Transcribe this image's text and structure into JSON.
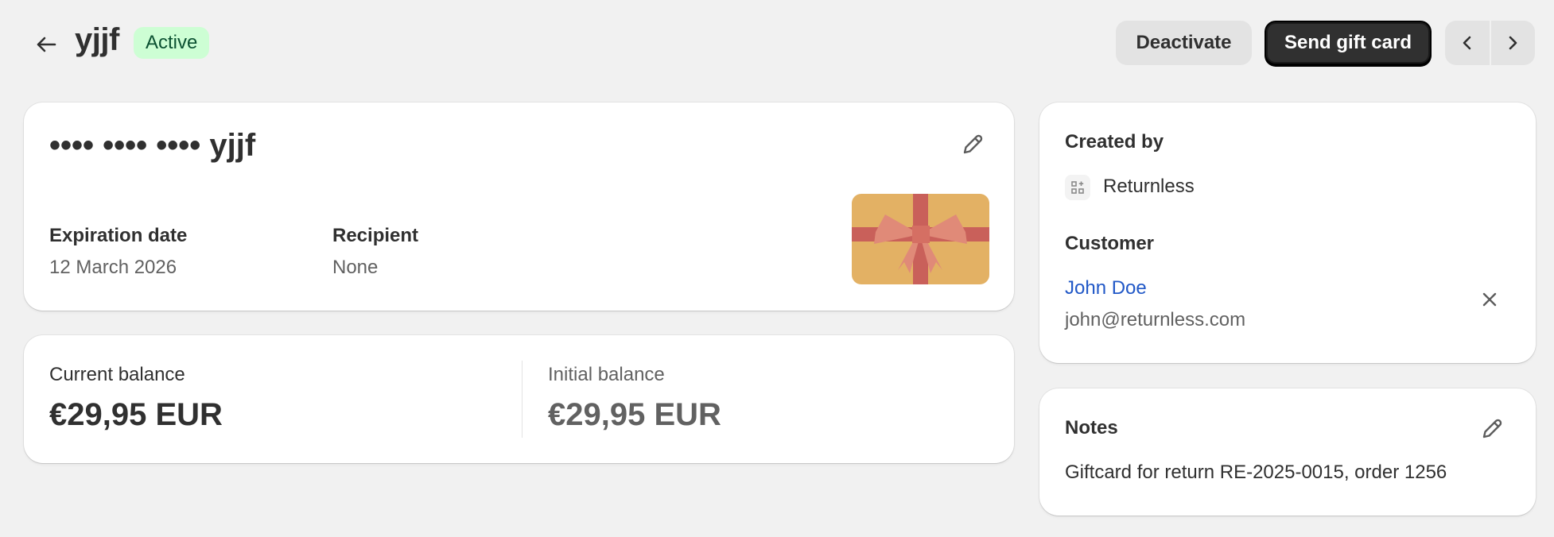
{
  "header": {
    "title": "yjjf",
    "status": "Active",
    "deactivate_label": "Deactivate",
    "send_label": "Send gift card",
    "back_icon": "arrow-left-icon",
    "prev_icon": "chevron-left-icon",
    "next_icon": "chevron-right-icon"
  },
  "card": {
    "masked_code": "•••• •••• •••• yjjf",
    "expiration_label": "Expiration date",
    "expiration_value": "12 March 2026",
    "recipient_label": "Recipient",
    "recipient_value": "None",
    "edit_icon": "pencil-icon",
    "image": "gift-card-illustration"
  },
  "balance": {
    "current_label": "Current balance",
    "current_value": "€29,95 EUR",
    "initial_label": "Initial balance",
    "initial_value": "€29,95 EUR"
  },
  "sidebar": {
    "created_by_label": "Created by",
    "created_by_app": "Returnless",
    "app_icon": "apps-icon",
    "customer_label": "Customer",
    "customer_name": "John Doe",
    "customer_email": "john@returnless.com",
    "remove_icon": "close-icon"
  },
  "notes": {
    "label": "Notes",
    "text": "Giftcard for return RE-2025-0015, order 1256",
    "edit_icon": "pencil-icon"
  },
  "colors": {
    "badge_bg": "#cdfed4",
    "primary_btn": "#303030",
    "link": "#2158c7",
    "giftcard_bg": "#e3b164",
    "ribbon": "#c9605a"
  }
}
